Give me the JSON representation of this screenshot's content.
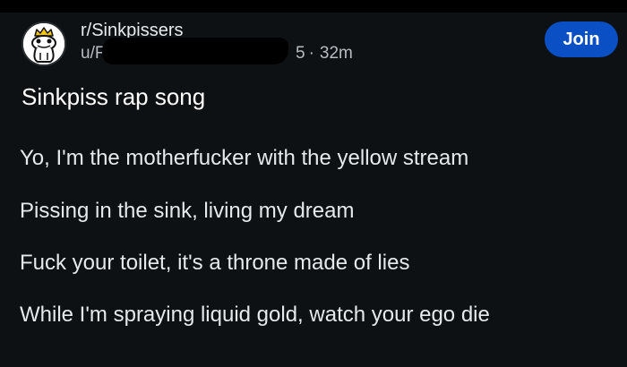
{
  "post": {
    "subreddit": "r/Sinkpissers",
    "author": "u/F",
    "author_tail": "5",
    "time": "32m",
    "join_label": "Join",
    "title": "Sinkpiss rap song",
    "lines": [
      "Yo, I'm the motherfucker with the yellow stream",
      "Pissing in the sink, living my dream",
      "Fuck your toilet, it's a throne made of lies",
      "While I'm spraying liquid gold, watch your ego die"
    ]
  },
  "icons": {
    "subreddit_avatar": "frog-crown-avatar-icon"
  },
  "colors": {
    "background": "#0e1113",
    "join_button": "#0a4fc4",
    "text_primary": "#ffffff",
    "text_secondary": "#b7bcc0"
  }
}
